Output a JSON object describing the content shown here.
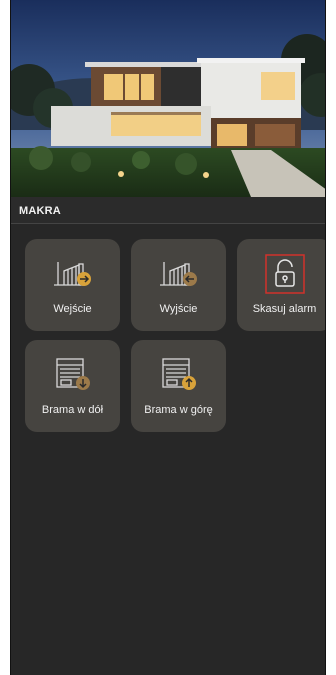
{
  "header": {
    "title": "MAKRA"
  },
  "tiles": [
    {
      "label": "Wejście",
      "icon": "gate-arrow-right-icon"
    },
    {
      "label": "Wyjście",
      "icon": "gate-arrow-left-icon"
    },
    {
      "label": "Skasuj alarm",
      "icon": "unlock-alarm-icon"
    },
    {
      "label": "Brama w dół",
      "icon": "garage-door-down-icon"
    },
    {
      "label": "Brama w górę",
      "icon": "garage-door-up-icon"
    }
  ],
  "colors": {
    "background": "#272727",
    "tile": "#464440",
    "accent_gold": "#d8a23a",
    "accent_red": "#d1312b",
    "text": "#f0f0f0"
  }
}
